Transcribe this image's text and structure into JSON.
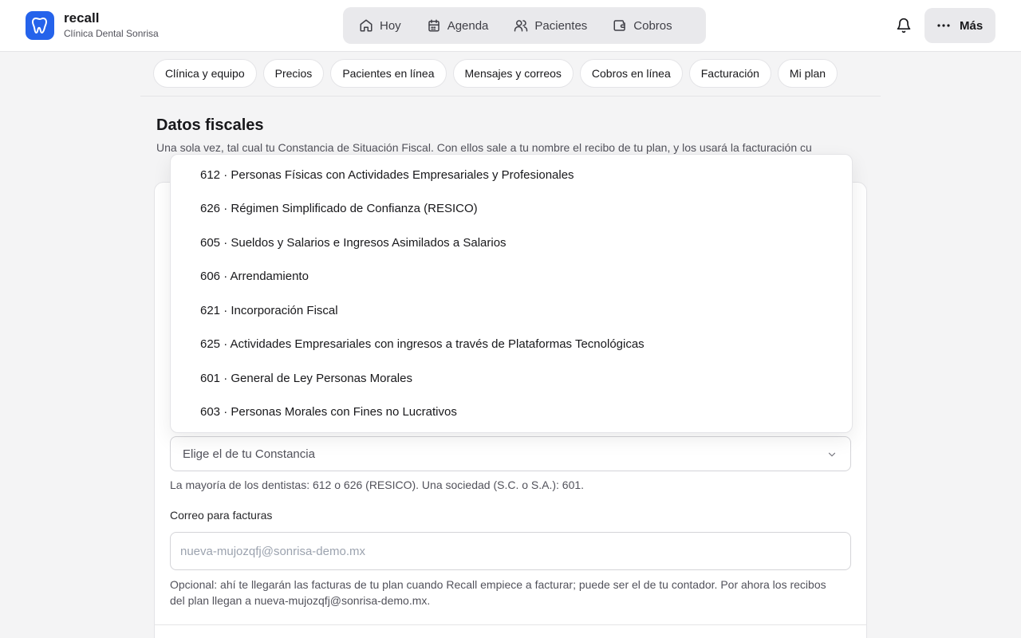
{
  "brand": {
    "name": "recall",
    "subtitle": "Clínica Dental Sonrisa",
    "logo_icon": "tooth-icon",
    "color": "#2563eb"
  },
  "nav": {
    "items": [
      {
        "label": "Hoy",
        "icon": "home-icon"
      },
      {
        "label": "Agenda",
        "icon": "calendar-icon"
      },
      {
        "label": "Pacientes",
        "icon": "users-icon"
      },
      {
        "label": "Cobros",
        "icon": "wallet-icon"
      }
    ],
    "more_label": "Más"
  },
  "subtabs": [
    "Clínica y equipo",
    "Precios",
    "Pacientes en línea",
    "Mensajes y correos",
    "Cobros en línea",
    "Facturación",
    "Mi plan"
  ],
  "section": {
    "title": "Datos fiscales",
    "description": "Una sola vez, tal cual tu Constancia de Situación Fiscal. Con ellos sale a tu nombre el recibo de tu plan, y los usará la facturación cu"
  },
  "regimen": {
    "placeholder": "Elige el de tu Constancia",
    "hint": "La mayoría de los dentistas: 612 o 626 (RESICO). Una sociedad (S.C. o S.A.): 601.",
    "options": [
      "612 · Personas Físicas con Actividades Empresariales y Profesionales",
      "626 · Régimen Simplificado de Confianza (RESICO)",
      "605 · Sueldos y Salarios e Ingresos Asimilados a Salarios",
      "606 · Arrendamiento",
      "621 · Incorporación Fiscal",
      "625 · Actividades Empresariales con ingresos a través de Plataformas Tecnológicas",
      "601 · General de Ley Personas Morales",
      "603 · Personas Morales con Fines no Lucrativos"
    ]
  },
  "email": {
    "label": "Correo para facturas",
    "placeholder": "nueva-mujozqfj@sonrisa-demo.mx",
    "value": "",
    "hint": "Opcional: ahí te llegarán las facturas de tu plan cuando Recall empiece a facturar; puede ser el de tu contador. Por ahora los recibos del plan llegan a nueva-mujozqfj@sonrisa-demo.mx."
  }
}
